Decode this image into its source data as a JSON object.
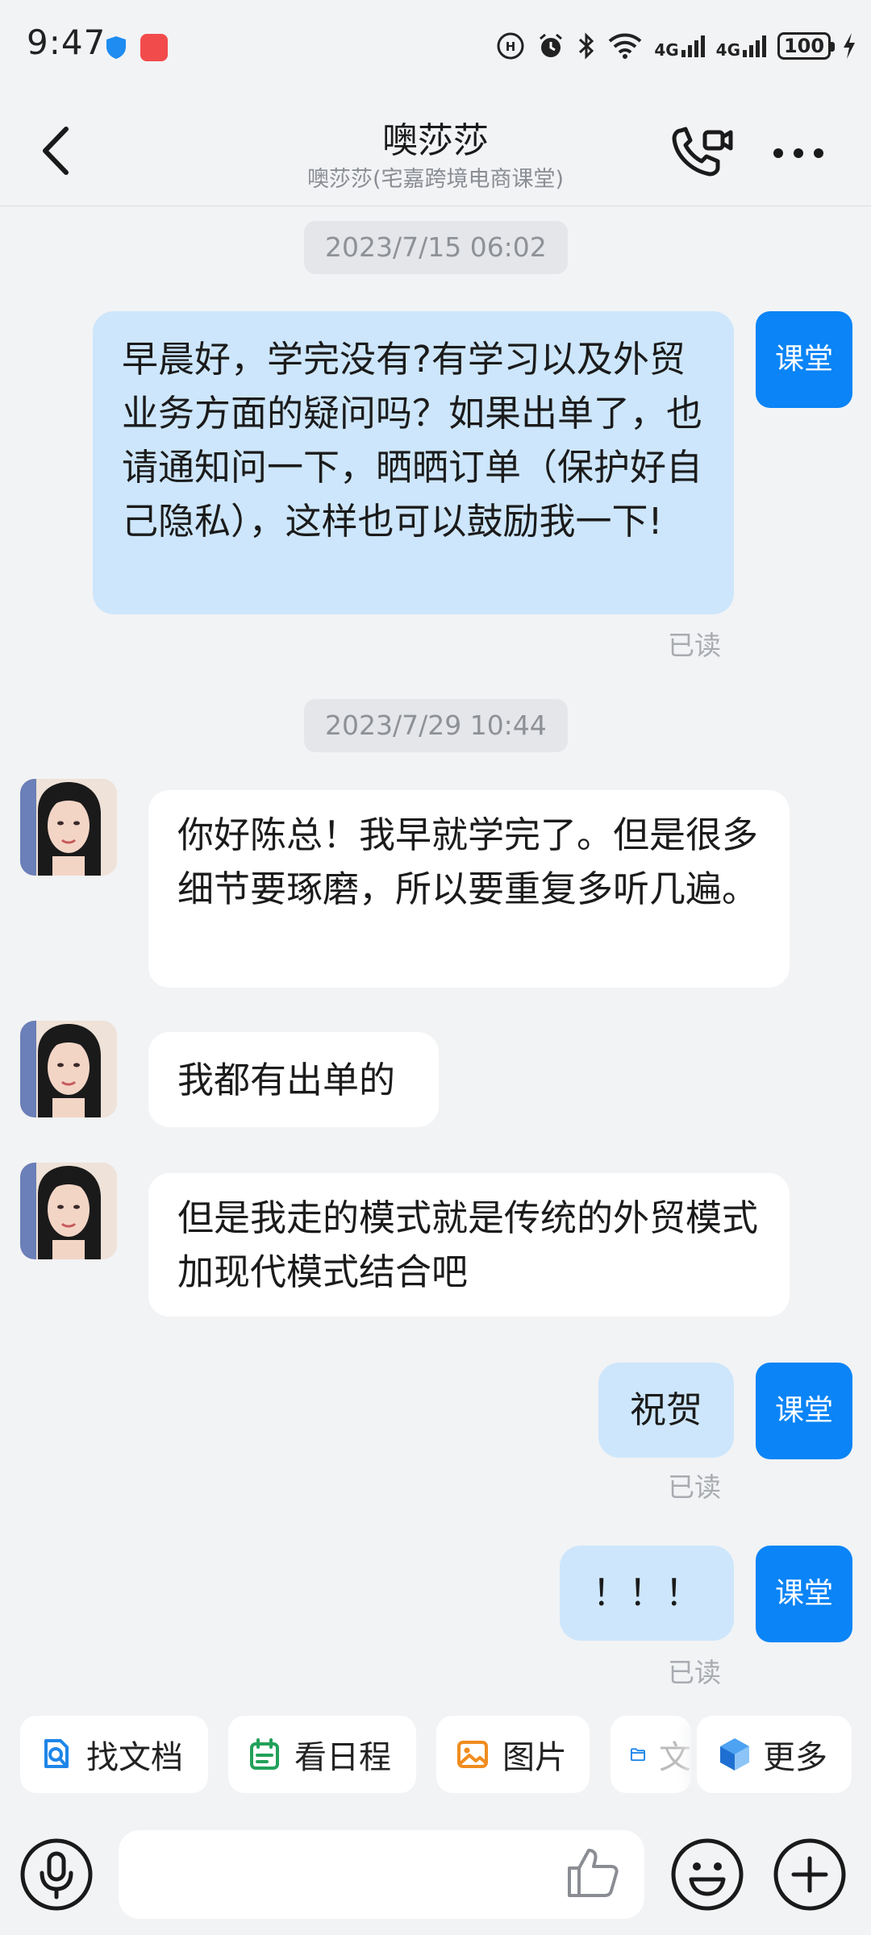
{
  "status_bar": {
    "time": "9:47",
    "network_1": "4G",
    "network_2": "4G",
    "battery": "100"
  },
  "header": {
    "title": "噢莎莎",
    "subtitle": "噢莎莎(宅嘉跨境电商课堂)"
  },
  "messages": {
    "timestamp_1": "2023/7/15 06:02",
    "msg_1": "早晨好，学完没有?有学习以及外贸业务方面的疑问吗？如果出单了，也请通知问一下，晒晒订单（保护好自己隐私），这样也可以鼓励我一下!",
    "read_1": "已读",
    "timestamp_2": "2023/7/29 10:44",
    "msg_2": "你好陈总！我早就学完了。但是很多细节要琢磨，所以要重复多听几遍。",
    "msg_3": "我都有出单的",
    "msg_4": "但是我走的模式就是传统的外贸模式加现代模式结合吧",
    "msg_5": "祝贺",
    "read_5": "已读",
    "msg_6": "！！！",
    "read_6": "已读"
  },
  "self_avatar_label": "课堂",
  "quick_actions": {
    "find_docs": "找文档",
    "schedule": "看日程",
    "images": "图片",
    "files": "文",
    "more": "更多"
  },
  "input": {
    "placeholder": ""
  },
  "colors": {
    "accent": "#0a84f6",
    "outgoing_bubble": "#cde6fb",
    "incoming_bubble": "#ffffff",
    "background": "#f2f3f5"
  },
  "icons": [
    "shield-icon",
    "app-badge-icon",
    "hd-call-icon",
    "alarm-icon",
    "bluetooth-icon",
    "wifi-icon",
    "signal-icon",
    "battery-icon",
    "charging-icon",
    "back-icon",
    "video-call-icon",
    "more-icon",
    "doc-search-icon",
    "calendar-icon",
    "image-icon",
    "folder-icon",
    "cube-icon",
    "microphone-icon",
    "thumbs-up-icon",
    "emoji-icon",
    "plus-icon"
  ]
}
